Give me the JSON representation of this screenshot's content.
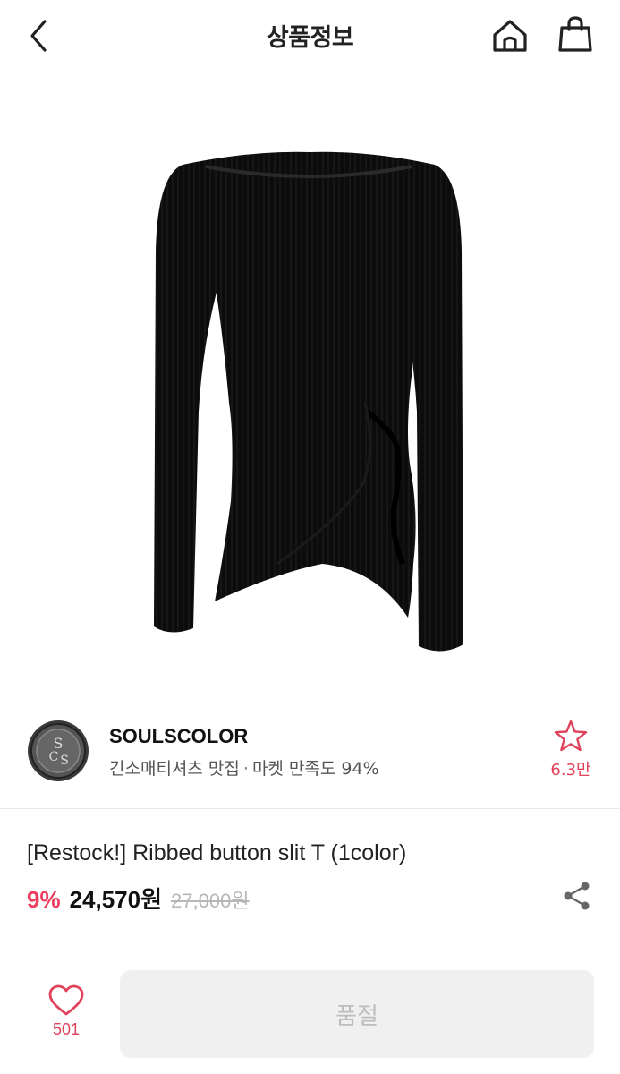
{
  "header": {
    "title": "상품정보",
    "back_icon": "chevron-left-icon",
    "home_icon": "home-icon",
    "bag_icon": "shopping-bag-icon"
  },
  "product_image": {
    "icon": "black-ribbed-long-sleeve-top-image"
  },
  "store": {
    "name": "SOULSCOLOR",
    "description": "긴소매티셔츠 맛집",
    "separator": "·",
    "satisfaction": "마켓 만족도 94%",
    "favorite_count": "6.3만",
    "favorite_icon": "star-outline-icon",
    "logo_icon": "soulscolor-logo"
  },
  "product": {
    "name": "[Restock!] Ribbed button slit T (1color)",
    "discount": "9%",
    "price": "24,570원",
    "original_price": "27,000원",
    "share_icon": "share-icon"
  },
  "bottom_bar": {
    "like_count": "501",
    "like_icon": "heart-outline-icon",
    "button_label": "품절"
  },
  "colors": {
    "accent": "#ec3d5e",
    "soldout_bg": "#f0f0f0",
    "soldout_text": "#bdbdbd"
  }
}
